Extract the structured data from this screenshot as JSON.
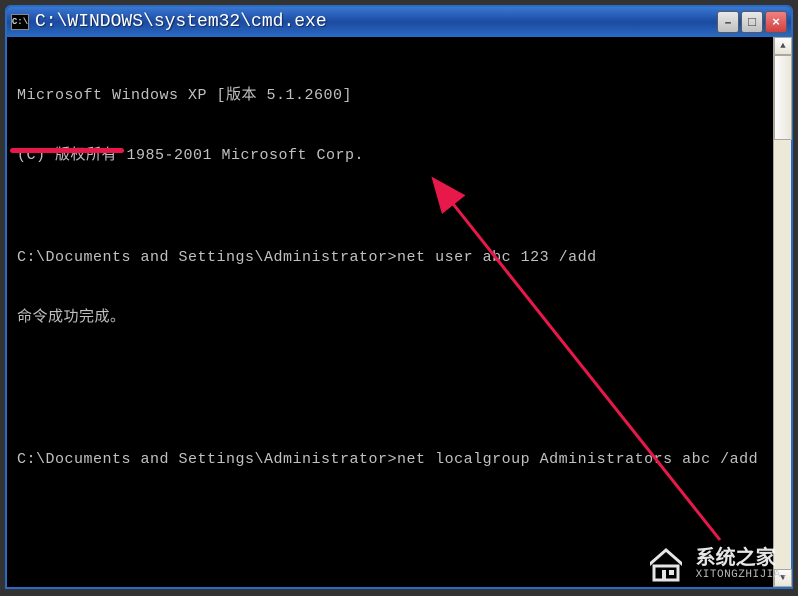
{
  "titlebar": {
    "icon_label": "C:\\",
    "title": "C:\\WINDOWS\\system32\\cmd.exe"
  },
  "controls": {
    "minimize": "–",
    "maximize": "□",
    "close": "×"
  },
  "terminal": {
    "line1": "Microsoft Windows XP [版本 5.1.2600]",
    "line2": "(C) 版权所有 1985-2001 Microsoft Corp.",
    "line3": "",
    "line4": "C:\\Documents and Settings\\Administrator>net user abc 123 /add",
    "line5": "命令成功完成。",
    "line6": "",
    "line7": "",
    "line8": "C:\\Documents and Settings\\Administrator>net localgroup Administrators abc /add"
  },
  "scrollbar": {
    "up": "▲",
    "down": "▼"
  },
  "watermark": {
    "title": "系统之家",
    "url": "XITONGZHIJIA."
  },
  "annotation": {
    "underline_color": "#e8194a",
    "arrow_color": "#e8194a"
  }
}
